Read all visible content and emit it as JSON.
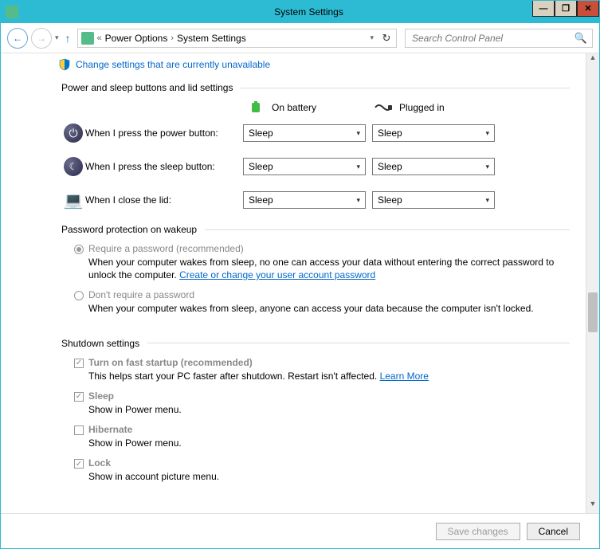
{
  "window": {
    "title": "System Settings"
  },
  "nav": {
    "breadcrumbs": [
      "Power Options",
      "System Settings"
    ],
    "search_placeholder": "Search Control Panel"
  },
  "top_link": "Change settings that are currently unavailable",
  "sections": {
    "buttons_lid": {
      "title": "Power and sleep buttons and lid settings",
      "cols": {
        "battery": "On battery",
        "plugged": "Plugged in"
      },
      "rows": {
        "power": {
          "label": "When I press the power button:",
          "battery": "Sleep",
          "plugged": "Sleep"
        },
        "sleep": {
          "label": "When I press the sleep button:",
          "battery": "Sleep",
          "plugged": "Sleep"
        },
        "lid": {
          "label": "When I close the lid:",
          "battery": "Sleep",
          "plugged": "Sleep"
        }
      }
    },
    "password": {
      "title": "Password protection on wakeup",
      "opt_require": {
        "label": "Require a password (recommended)",
        "desc_a": "When your computer wakes from sleep, no one can access your data without entering the correct password to unlock the computer. ",
        "link": "Create or change your user account password"
      },
      "opt_none": {
        "label": "Don't require a password",
        "desc": "When your computer wakes from sleep, anyone can access your data because the computer isn't locked."
      }
    },
    "shutdown": {
      "title": "Shutdown settings",
      "fast": {
        "label": "Turn on fast startup (recommended)",
        "desc_a": "This helps start your PC faster after shutdown. Restart isn't affected. ",
        "link": "Learn More",
        "checked": true
      },
      "sleep": {
        "label": "Sleep",
        "desc": "Show in Power menu.",
        "checked": true
      },
      "hiber": {
        "label": "Hibernate",
        "desc": "Show in Power menu.",
        "checked": false
      },
      "lock": {
        "label": "Lock",
        "desc": "Show in account picture menu.",
        "checked": true
      }
    }
  },
  "footer": {
    "save": "Save changes",
    "cancel": "Cancel"
  }
}
